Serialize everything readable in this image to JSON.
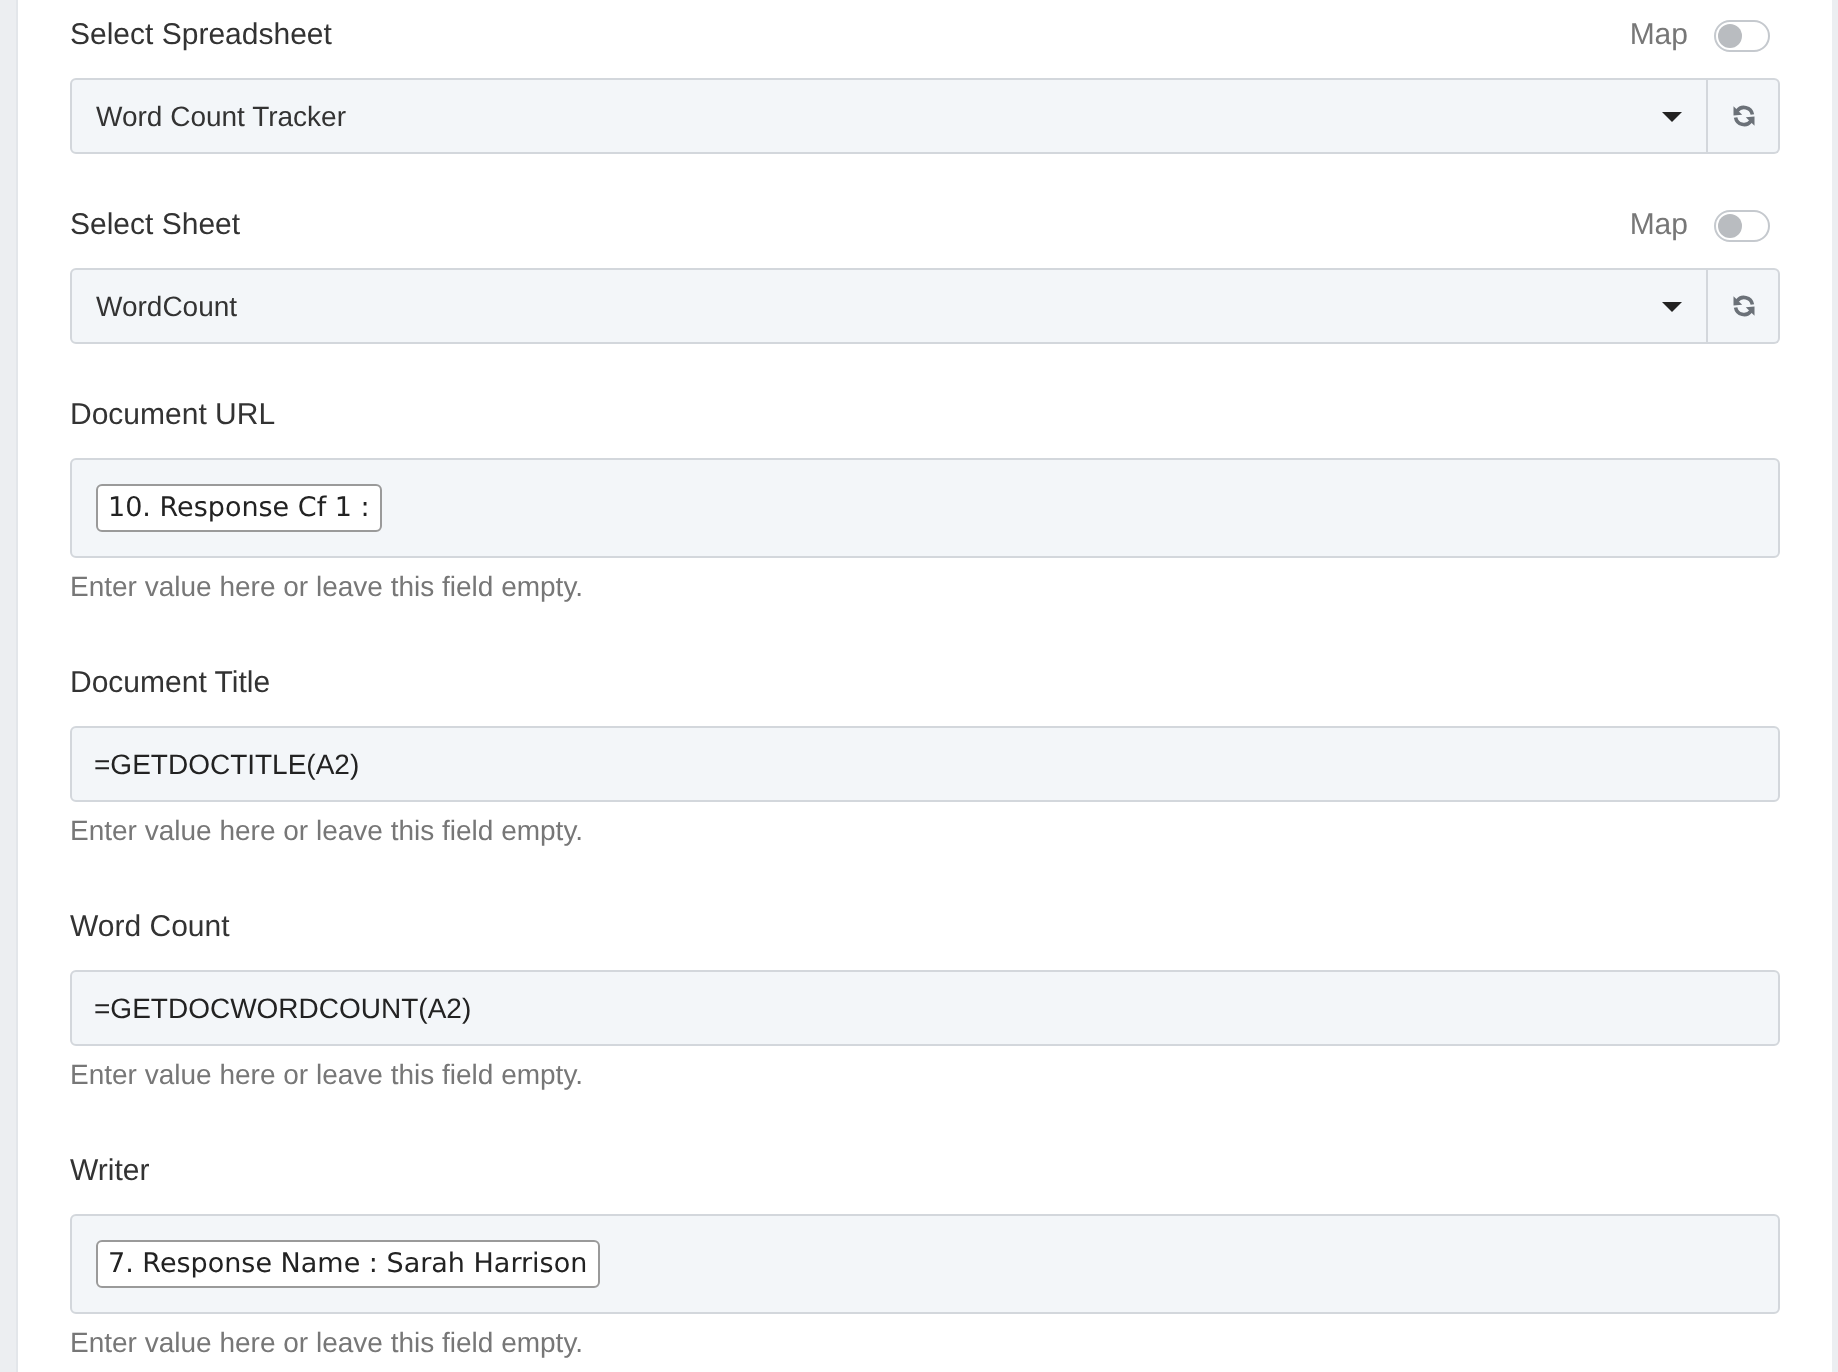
{
  "fields": [
    {
      "kind": "select",
      "label": "Select Spreadsheet",
      "map": {
        "label": "Map",
        "on": false
      },
      "value": "Word Count Tracker"
    },
    {
      "kind": "select",
      "label": "Select Sheet",
      "map": {
        "label": "Map",
        "on": false
      },
      "value": "WordCount"
    },
    {
      "kind": "tokens",
      "label": "Document URL",
      "tokens": [
        "10. Response Cf 1 :"
      ],
      "help": "Enter value here or leave this field empty."
    },
    {
      "kind": "text",
      "label": "Document Title",
      "value": "=GETDOCTITLE(A2)",
      "help": "Enter value here or leave this field empty."
    },
    {
      "kind": "text",
      "label": "Word Count",
      "value": "=GETDOCWORDCOUNT(A2)",
      "help": "Enter value here or leave this field empty."
    },
    {
      "kind": "tokens",
      "label": "Writer",
      "tokens": [
        "7. Response Name : Sarah Harrison"
      ],
      "help": "Enter value here or leave this field empty."
    }
  ]
}
